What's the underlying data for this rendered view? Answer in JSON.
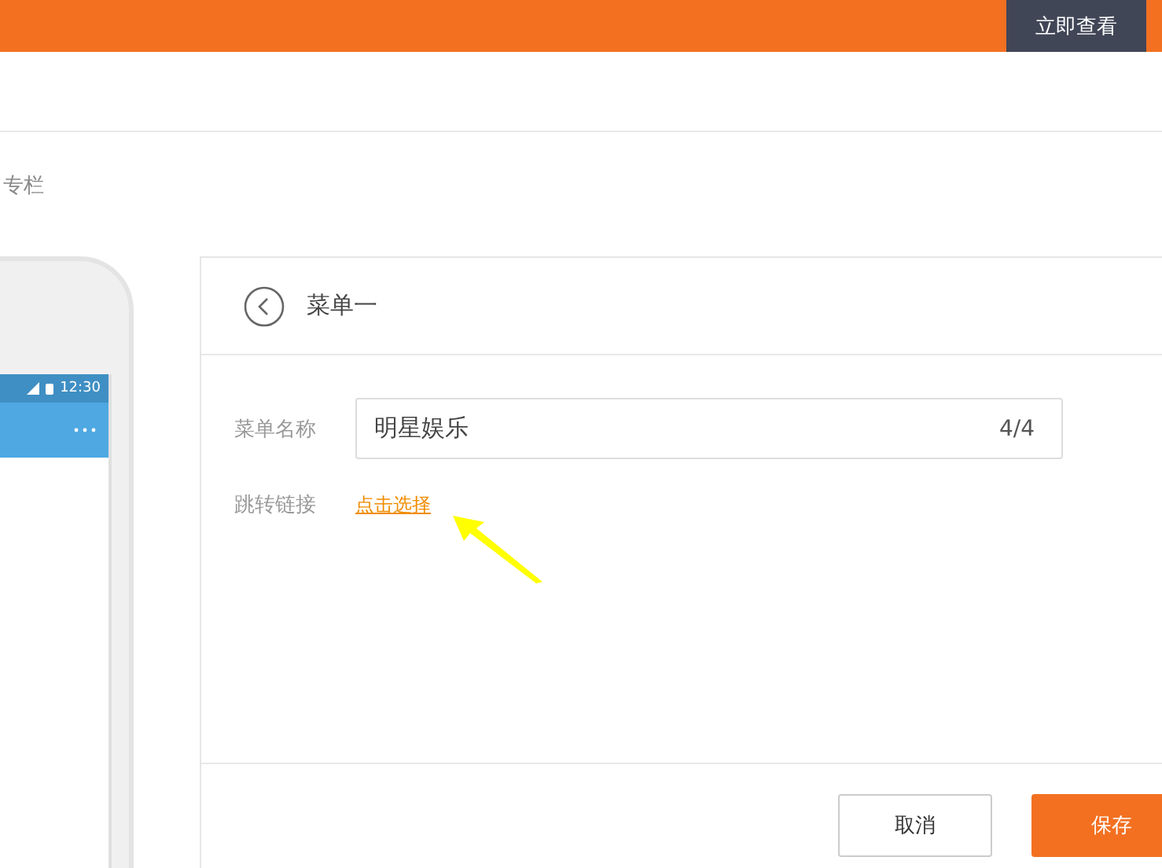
{
  "top_bar": {
    "button": "立即查看"
  },
  "breadcrumb": "专栏",
  "phone": {
    "time": "12:30"
  },
  "panel": {
    "title": "菜单一",
    "fields": [
      {
        "kind": "text",
        "label": "菜单名称",
        "value": "明星娱乐",
        "counter": "4/4"
      },
      {
        "kind": "link",
        "label": "跳转链接",
        "link": "点击选择"
      }
    ],
    "buttons": [
      {
        "kind": "secondary",
        "label": "取消"
      },
      {
        "kind": "primary",
        "label": "保存"
      }
    ]
  }
}
